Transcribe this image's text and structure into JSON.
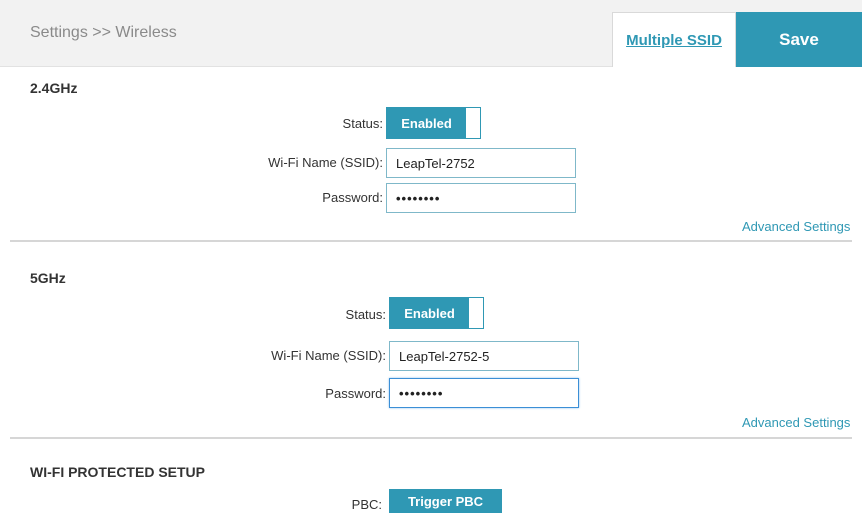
{
  "header": {
    "breadcrumb": "Settings >> Wireless",
    "multiple_ssid_label": "Multiple SSID",
    "save_label": "Save"
  },
  "colors": {
    "accent": "#2f98b4",
    "header_bg": "#f2f2f2",
    "divider": "#d6d6d6"
  },
  "band_24": {
    "title": "2.4GHz",
    "status_label": "Status:",
    "status_value": "Enabled",
    "ssid_label": "Wi-Fi Name (SSID):",
    "ssid_value": "LeapTel-2752",
    "password_label": "Password:",
    "password_value": "••••••••",
    "advanced_link": "Advanced Settings"
  },
  "band_5": {
    "title": "5GHz",
    "status_label": "Status:",
    "status_value": "Enabled",
    "ssid_label": "Wi-Fi Name (SSID):",
    "ssid_value": "LeapTel-2752-5",
    "password_label": "Password:",
    "password_value": "••••••••",
    "advanced_link": "Advanced Settings"
  },
  "wps": {
    "title": "WI-FI PROTECTED SETUP",
    "pbc_label": "PBC:",
    "pbc_button": "Trigger PBC"
  }
}
